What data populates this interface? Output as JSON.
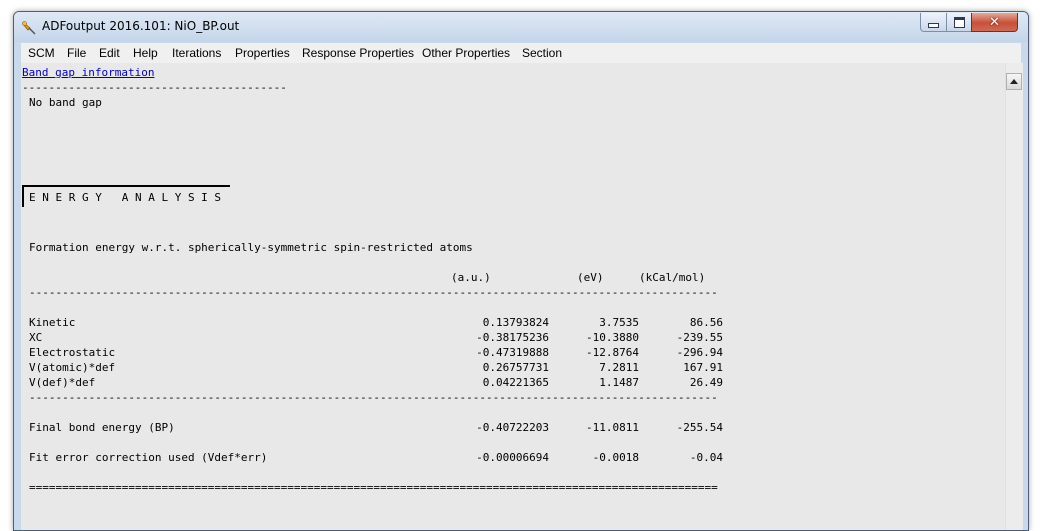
{
  "window": {
    "title": "ADFoutput 2016.101: NiO_BP.out"
  },
  "menu": [
    "SCM",
    "File",
    "Edit",
    "Help",
    "Iterations",
    "Properties",
    "Response Properties",
    "Other Properties",
    "Section"
  ],
  "content": {
    "link": "Band gap information",
    "dash_short": "----------------------------------------",
    "no_band_gap": "No band gap",
    "energy_heading": "E N E R G Y   A N A L Y S I S",
    "formation": "Formation energy w.r.t. spherically-symmetric spin-restricted atoms",
    "headers": {
      "au": "(a.u.)",
      "ev": "(eV)",
      "kcal": "(kCal/mol)"
    },
    "dash_long": "--------------------------------------------------------------------------------------------------------",
    "rows": [
      {
        "label": "Kinetic",
        "au": "0.13793824",
        "ev": "3.7535",
        "kcal": "86.56"
      },
      {
        "label": "XC",
        "au": "-0.38175236",
        "ev": "-10.3880",
        "kcal": "-239.55"
      },
      {
        "label": "Electrostatic",
        "au": "-0.47319888",
        "ev": "-12.8764",
        "kcal": "-296.94"
      },
      {
        "label": "V(atomic)*def",
        "au": "0.26757731",
        "ev": "7.2811",
        "kcal": "167.91"
      },
      {
        "label": "V(def)*def",
        "au": "0.04221365",
        "ev": "1.1487",
        "kcal": "26.49"
      }
    ],
    "final": {
      "label": "Final bond energy (BP)",
      "au": "-0.40722203",
      "ev": "-11.0811",
      "kcal": "-255.54"
    },
    "fit": {
      "label": "Fit error correction used (Vdef*err)",
      "au": "-0.00006694",
      "ev": "-0.0018",
      "kcal": "-0.04"
    },
    "equals_line": "========================================================================================================"
  },
  "icons": {
    "app": "pin-icon",
    "minimize": "minimize-icon",
    "maximize": "maximize-icon",
    "close": "close-icon",
    "scroll_up": "scroll-up-arrow-icon"
  }
}
